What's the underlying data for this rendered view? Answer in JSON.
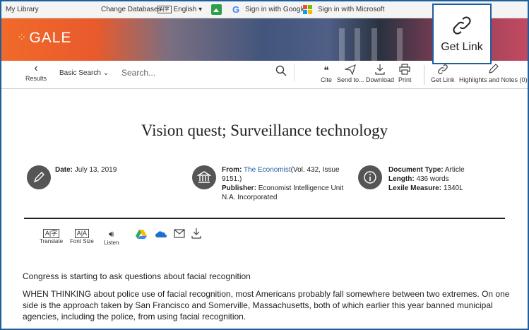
{
  "topbar": {
    "my_library": "My Library",
    "change_databases": "Change Databases",
    "language": "English",
    "sign_in_google": "Sign in with Google",
    "sign_in_microsoft": "Sign in with Microsoft"
  },
  "brand": {
    "logo": "GALE",
    "accent": "#f06a2a"
  },
  "toolbar": {
    "back_label": "Results",
    "search_type": "Basic Search",
    "search_placeholder": "Search...",
    "cite": "Cite",
    "send_to": "Send to...",
    "download": "Download",
    "print": "Print",
    "get_link": "Get Link",
    "highlights": "Highlights and Notes (0)"
  },
  "callout": {
    "label": "Get Link"
  },
  "article": {
    "title": "Vision quest; Surveillance technology",
    "date_label": "Date:",
    "date": "July 13, 2019",
    "from_label": "From:",
    "source": "The Economist",
    "source_detail": "(Vol. 432, Issue 9151.)",
    "publisher_label": "Publisher:",
    "publisher": "Economist Intelligence Unit N.A. Incorporated",
    "doctype_label": "Document Type:",
    "doctype": "Article",
    "length_label": "Length:",
    "length": "436 words",
    "lexile_label": "Lexile Measure:",
    "lexile": "1340L",
    "subtitle": "Congress is starting to ask questions about facial recognition",
    "body": "WHEN THINKING about police use of facial recognition, most Americans probably fall somewhere between two extremes. On one side is the approach taken by San Francisco and Somerville, Massachusetts, both of which earlier this year banned municipal agencies, including the police, from using facial recognition."
  },
  "tools": {
    "translate": "Translate",
    "font_size": "Font Size",
    "listen": "Listen"
  }
}
